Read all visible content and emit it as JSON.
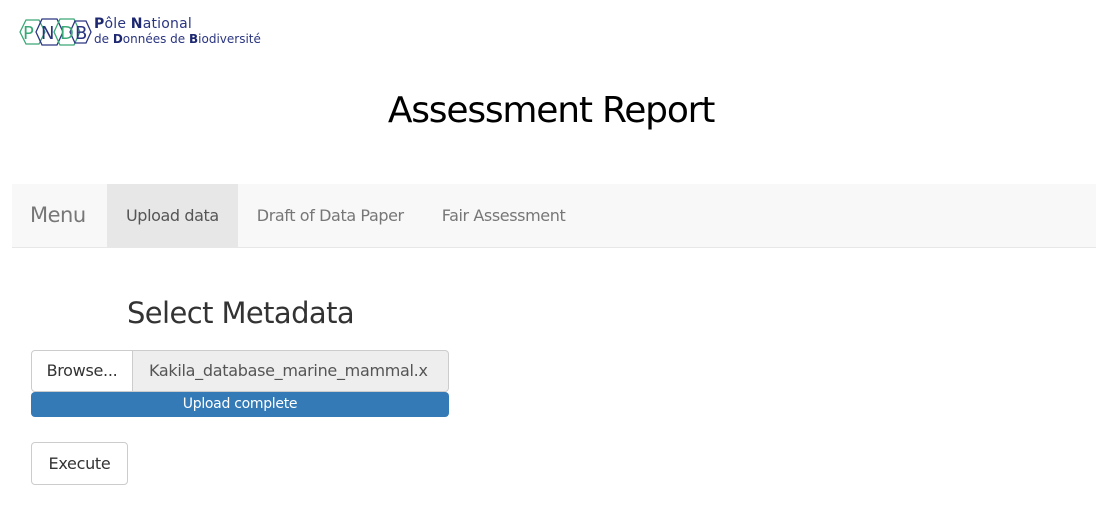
{
  "logo": {
    "letters": [
      "P",
      "N",
      "D",
      "B"
    ],
    "line1_parts": [
      "P",
      "ôle  ",
      "N",
      "ational"
    ],
    "line2_parts": [
      "de ",
      "D",
      "onnées de ",
      "B",
      "iodiversité"
    ]
  },
  "page": {
    "title": "Assessment Report"
  },
  "navbar": {
    "brand": "Menu",
    "items": [
      {
        "label": "Upload data",
        "active": true
      },
      {
        "label": "Draft of Data Paper",
        "active": false
      },
      {
        "label": "Fair Assessment",
        "active": false
      }
    ]
  },
  "upload": {
    "section_title": "Select Metadata",
    "browse_label": "Browse...",
    "file_name": "Kakila_database_marine_mammal.x",
    "progress_label": "Upload complete",
    "progress_percent": 100
  },
  "actions": {
    "execute_label": "Execute"
  },
  "colors": {
    "primary": "#337ab7",
    "navbar_bg": "#f8f8f8",
    "nav_active_bg": "#e7e7e7",
    "logo_blue": "#2a3580",
    "logo_green": "#3aa876"
  }
}
